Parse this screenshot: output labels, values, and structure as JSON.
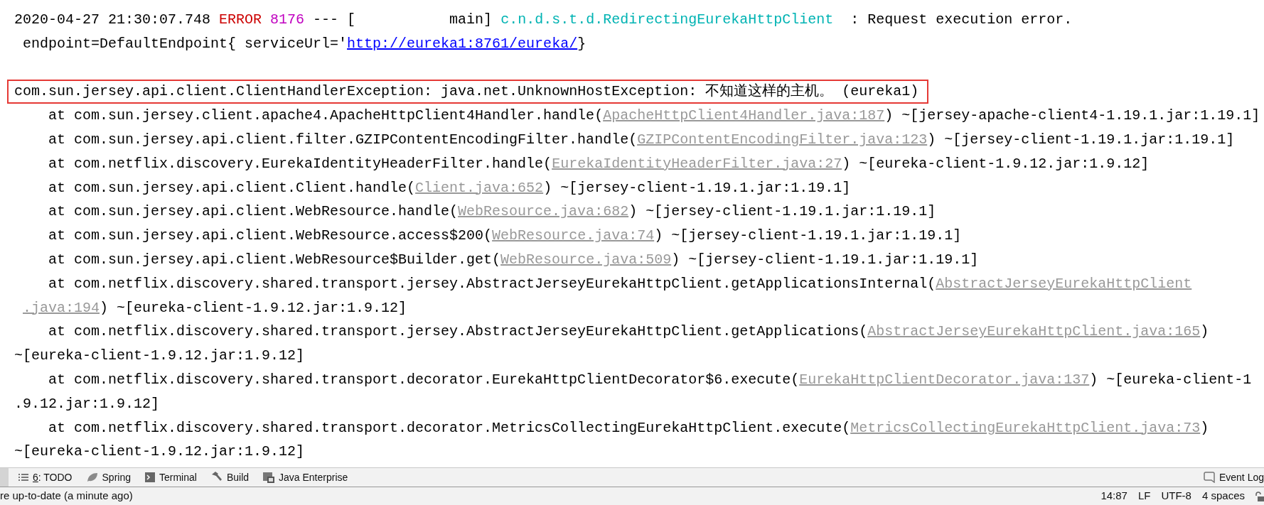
{
  "console": {
    "rows": [
      {
        "kind": "header",
        "segments": [
          {
            "kind": "plain",
            "text": "2020-04-27 21:30:07.748 "
          },
          {
            "kind": "level",
            "text": "ERROR"
          },
          {
            "kind": "pid",
            "text": "8176"
          },
          {
            "kind": "plain",
            "text": " --- [           main] "
          },
          {
            "kind": "logger",
            "text": "c.n.d.s.t.d.RedirectingEurekaHttpClient"
          },
          {
            "kind": "plain",
            "text": "  : Request execution error."
          }
        ]
      },
      {
        "kind": "continued",
        "segments": [
          {
            "kind": "plain",
            "text": "endpoint=DefaultEndpoint{ serviceUrl='"
          },
          {
            "kind": "url",
            "text": "http://eureka1:8761/eureka/"
          },
          {
            "kind": "plain",
            "text": "}"
          }
        ]
      },
      {
        "kind": "header",
        "blank_before": true,
        "highlighted": true,
        "segments": [
          {
            "kind": "plain",
            "text": "com.sun.jersey.api.client.ClientHandlerException: java.net.UnknownHostException: 不知道这样的主机。 (eureka1)"
          }
        ]
      },
      {
        "kind": "frame",
        "segments": [
          {
            "kind": "plain",
            "text": "at com.sun.jersey.client.apache4.ApacheHttpClient4Handler.handle("
          },
          {
            "kind": "source",
            "text": "ApacheHttpClient4Handler.java:187"
          },
          {
            "kind": "plain",
            "text": ") ~[jersey-apache-client4-1.19.1.jar:1.19.1]"
          }
        ]
      },
      {
        "kind": "frame",
        "segments": [
          {
            "kind": "plain",
            "text": "at com.sun.jersey.api.client.filter.GZIPContentEncodingFilter.handle("
          },
          {
            "kind": "source",
            "text": "GZIPContentEncodingFilter.java:123"
          },
          {
            "kind": "plain",
            "text": ") ~[jersey-client-1.19.1.jar:1.19.1]"
          }
        ]
      },
      {
        "kind": "frame",
        "segments": [
          {
            "kind": "plain",
            "text": "at com.netflix.discovery.EurekaIdentityHeaderFilter.handle("
          },
          {
            "kind": "source",
            "text": "EurekaIdentityHeaderFilter.java:27"
          },
          {
            "kind": "plain",
            "text": ") ~[eureka-client-1.9.12.jar:1.9.12]"
          }
        ]
      },
      {
        "kind": "frame",
        "segments": [
          {
            "kind": "plain",
            "text": "at com.sun.jersey.api.client.Client.handle("
          },
          {
            "kind": "source",
            "text": "Client.java:652"
          },
          {
            "kind": "plain",
            "text": ") ~[jersey-client-1.19.1.jar:1.19.1]"
          }
        ]
      },
      {
        "kind": "frame",
        "segments": [
          {
            "kind": "plain",
            "text": "at com.sun.jersey.api.client.WebResource.handle("
          },
          {
            "kind": "source",
            "text": "WebResource.java:682"
          },
          {
            "kind": "plain",
            "text": ") ~[jersey-client-1.19.1.jar:1.19.1]"
          }
        ]
      },
      {
        "kind": "frame",
        "segments": [
          {
            "kind": "plain",
            "text": "at com.sun.jersey.api.client.WebResource.access$200("
          },
          {
            "kind": "source",
            "text": "WebResource.java:74"
          },
          {
            "kind": "plain",
            "text": ") ~[jersey-client-1.19.1.jar:1.19.1]"
          }
        ]
      },
      {
        "kind": "frame",
        "segments": [
          {
            "kind": "plain",
            "text": "at com.sun.jersey.api.client.WebResource$Builder.get("
          },
          {
            "kind": "source",
            "text": "WebResource.java:509"
          },
          {
            "kind": "plain",
            "text": ") ~[jersey-client-1.19.1.jar:1.19.1]"
          }
        ]
      },
      {
        "kind": "frame",
        "segments": [
          {
            "kind": "plain",
            "text": "at com.netflix.discovery.shared.transport.jersey.AbstractJerseyEurekaHttpClient.getApplicationsInternal("
          },
          {
            "kind": "source",
            "text": "AbstractJerseyEurekaHttpClient"
          }
        ]
      },
      {
        "kind": "continued",
        "segments": [
          {
            "kind": "source",
            "text": ".java:194"
          },
          {
            "kind": "plain",
            "text": ") ~[eureka-client-1.9.12.jar:1.9.12]"
          }
        ]
      },
      {
        "kind": "frame",
        "segments": [
          {
            "kind": "plain",
            "text": "at com.netflix.discovery.shared.transport.jersey.AbstractJerseyEurekaHttpClient.getApplications("
          },
          {
            "kind": "source",
            "text": "AbstractJerseyEurekaHttpClient.java:165"
          },
          {
            "kind": "plain",
            "text": ")"
          }
        ]
      },
      {
        "kind": "header",
        "segments": [
          {
            "kind": "plain",
            "text": "~[eureka-client-1.9.12.jar:1.9.12]"
          }
        ]
      },
      {
        "kind": "frame",
        "segments": [
          {
            "kind": "plain",
            "text": "at com.netflix.discovery.shared.transport.decorator.EurekaHttpClientDecorator$6.execute("
          },
          {
            "kind": "source",
            "text": "EurekaHttpClientDecorator.java:137"
          },
          {
            "kind": "plain",
            "text": ") ~[eureka-client-1"
          }
        ]
      },
      {
        "kind": "header",
        "segments": [
          {
            "kind": "plain",
            "text": ".9.12.jar:1.9.12]"
          }
        ]
      },
      {
        "kind": "frame",
        "segments": [
          {
            "kind": "plain",
            "text": "at com.netflix.discovery.shared.transport.decorator.MetricsCollectingEurekaHttpClient.execute("
          },
          {
            "kind": "source",
            "text": "MetricsCollectingEurekaHttpClient.java:73"
          },
          {
            "kind": "plain",
            "text": ")"
          }
        ]
      },
      {
        "kind": "header",
        "segments": [
          {
            "kind": "plain",
            "text": "~[eureka-client-1.9.12.jar:1.9.12]"
          }
        ]
      }
    ]
  },
  "tool_windows": {
    "left": [
      {
        "kind": "todo",
        "label": "6: TODO",
        "mnemonic": true
      },
      {
        "kind": "spring",
        "label": "Spring",
        "mnemonic": false
      },
      {
        "kind": "terminal",
        "label": "Terminal",
        "mnemonic": false
      },
      {
        "kind": "build",
        "label": "Build",
        "mnemonic": false
      },
      {
        "kind": "enterprise",
        "label": "Java Enterprise",
        "mnemonic": false
      }
    ],
    "right": [
      {
        "kind": "event",
        "label": "Event Log",
        "mnemonic": false
      }
    ]
  },
  "status_bar": {
    "message": "re up-to-date (a minute ago)",
    "items": [
      "14:87",
      "LF",
      "UTF-8",
      "4 spaces"
    ],
    "locked": false
  }
}
